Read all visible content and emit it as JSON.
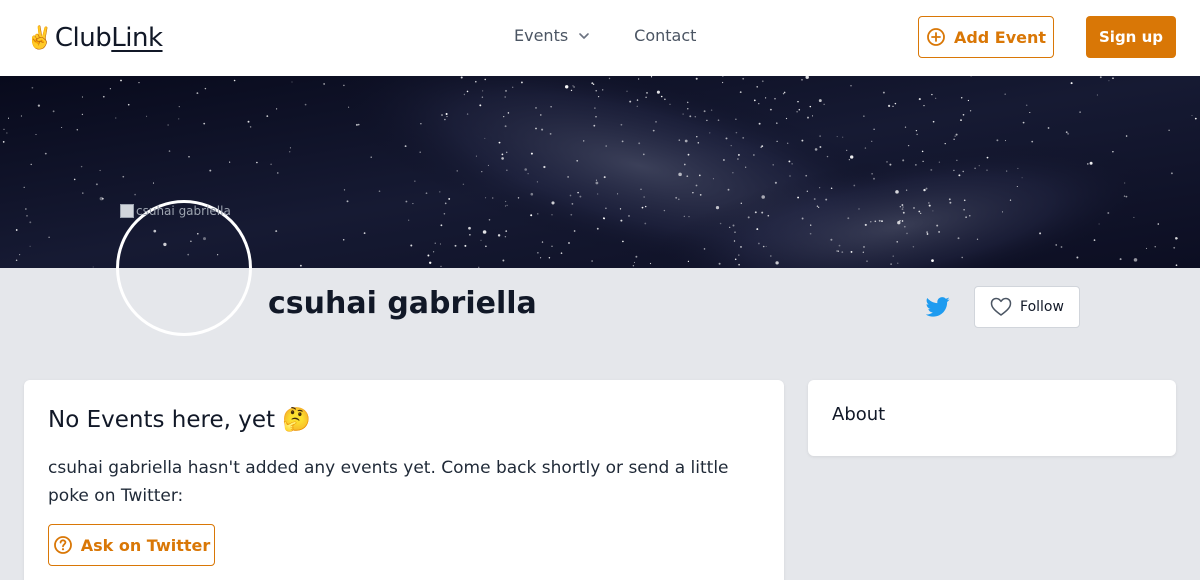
{
  "header": {
    "logo_emoji": "✌️",
    "logo_club": "Club",
    "logo_link": "Link",
    "nav": [
      {
        "label": "Events",
        "icon": "chevron-down-icon"
      },
      {
        "label": "Contact"
      }
    ],
    "add_event_label": "Add Event",
    "sign_up_label": "Sign up",
    "accent_color": "#d97706"
  },
  "profile": {
    "avatar_alt": "csuhai gabriella",
    "name": "csuhai gabriella",
    "follow_label": "Follow"
  },
  "events_card": {
    "title": "No Events here, yet 🤔",
    "text": "csuhai gabriella hasn't added any events yet. Come back shortly or send a little poke on Twitter:",
    "ask_label": "Ask on Twitter"
  },
  "about": {
    "title": "About"
  }
}
